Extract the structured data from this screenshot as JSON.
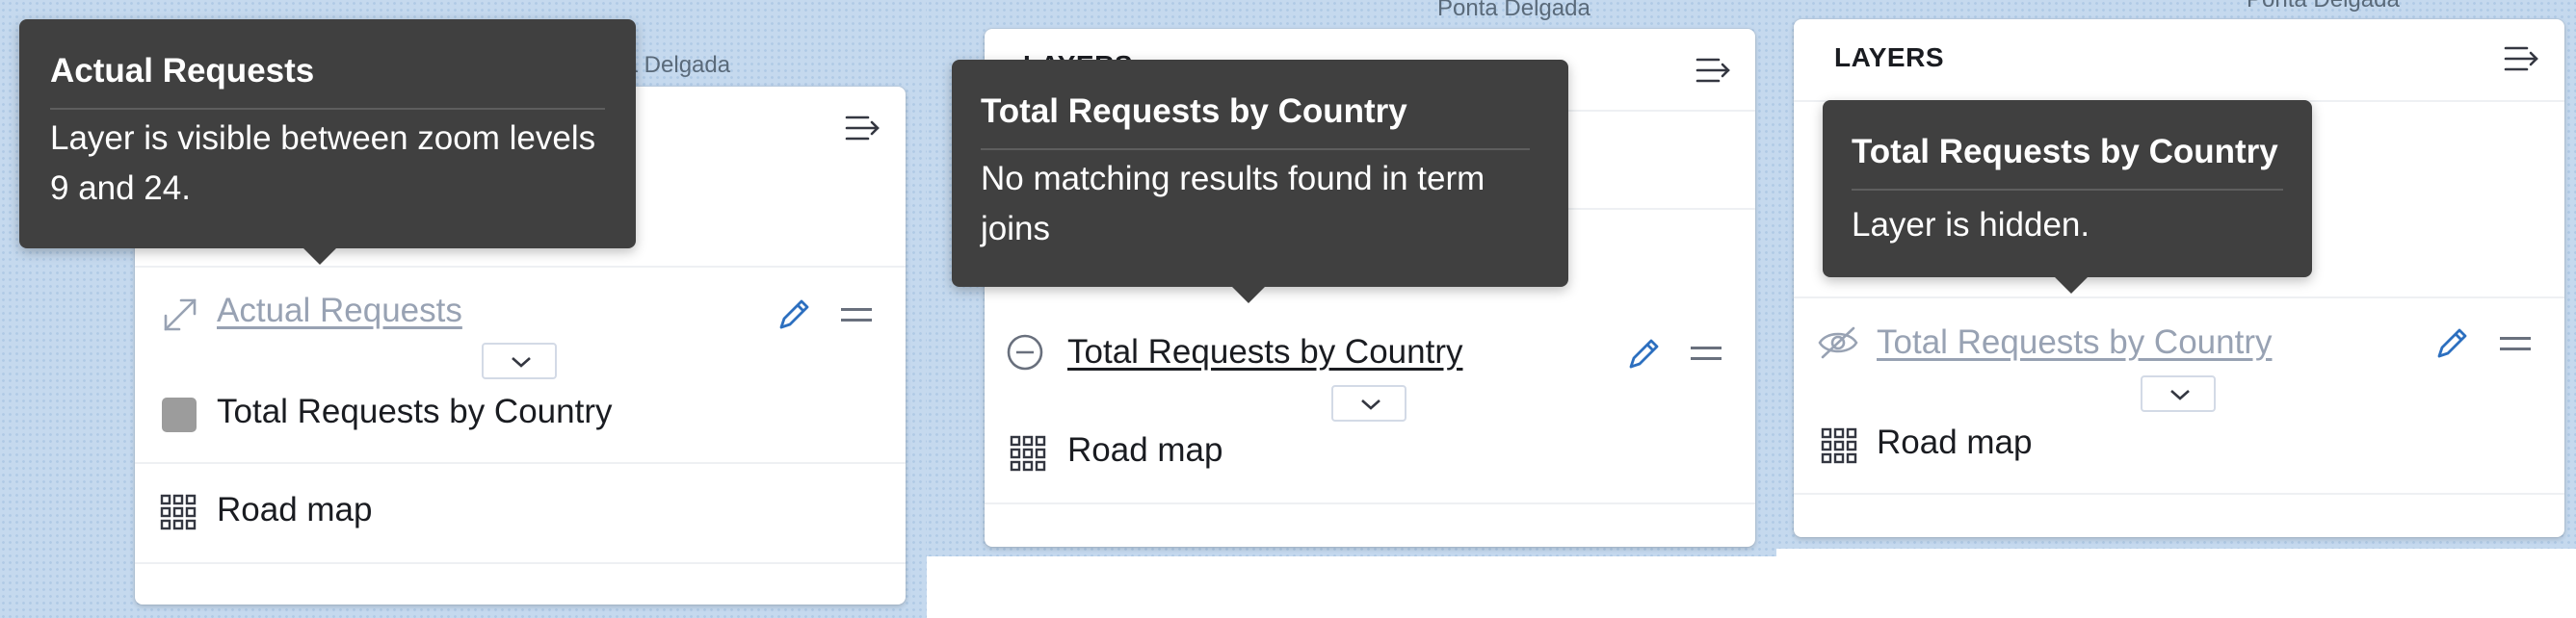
{
  "city_label": "Ponta Delgada",
  "city_label_clipped": "ta Delgada",
  "panel_title": "LAYERS",
  "panel_title_clipped": "LAYERS",
  "frames": [
    {
      "tooltip": {
        "title": "Actual Requests",
        "body": "Layer is visible between zoom levels 9 and 24."
      },
      "layers": [
        {
          "name": "Actual Requests",
          "status_icon": "resize-diagonal-icon",
          "state": "out-of-zoom-range"
        },
        {
          "name": "Total Requests by Country",
          "status_icon": "gray-square-swatch",
          "state": "normal"
        },
        {
          "name": "Road map",
          "status_icon": "grid-icon",
          "state": "normal"
        }
      ]
    },
    {
      "tooltip": {
        "title": "Total Requests by Country",
        "body": "No matching results found in term joins"
      },
      "layers": [
        {
          "name": "Total Requests by Country",
          "status_icon": "minus-circle-icon",
          "state": "no-join-results"
        },
        {
          "name": "Road map",
          "status_icon": "grid-icon",
          "state": "normal"
        }
      ]
    },
    {
      "tooltip": {
        "title": "Total Requests by Country",
        "body": "Layer is hidden."
      },
      "layers": [
        {
          "name": "Total Requests by Country",
          "status_icon": "eye-closed-icon",
          "state": "hidden"
        },
        {
          "name": "Road map",
          "status_icon": "grid-icon",
          "state": "normal"
        }
      ]
    }
  ],
  "colors": {
    "map_water": "#c5d9ee",
    "tooltip_bg": "#404040",
    "edit_icon": "#2c6fbf",
    "dim_text": "#98a2b3"
  }
}
